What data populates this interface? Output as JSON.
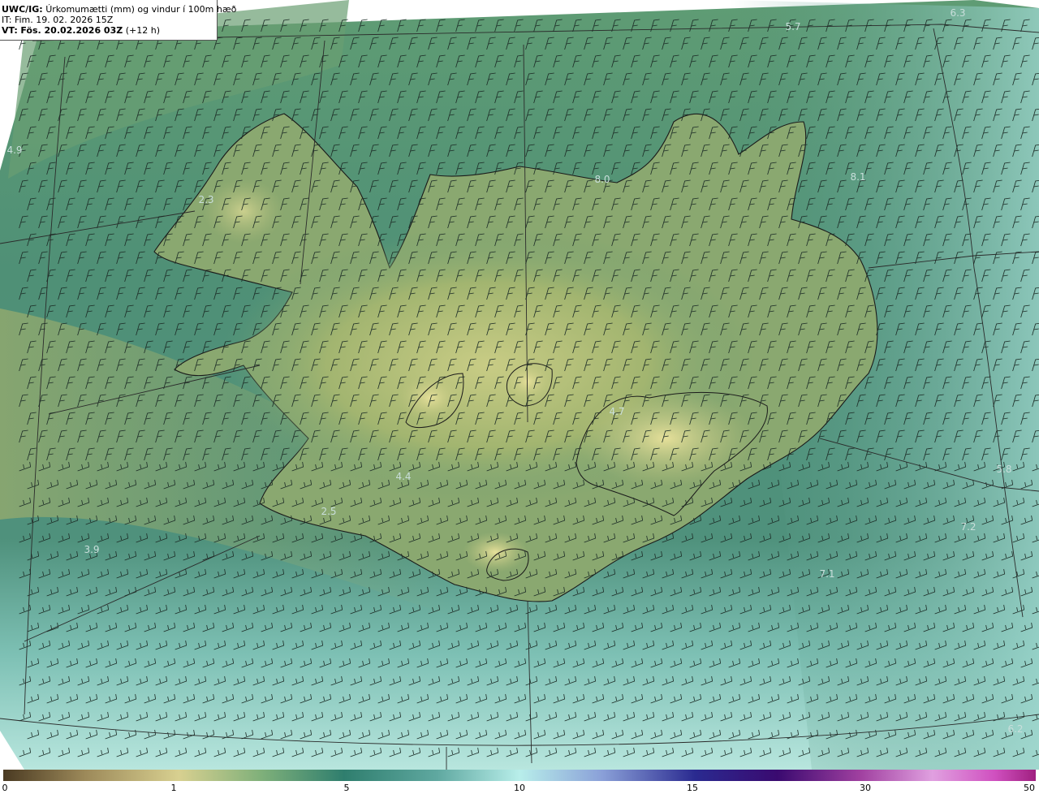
{
  "header": {
    "model_label": "UWC/IG:",
    "product": "Úrkomumætti (mm) og vindur í 100m hæð",
    "init_time": "IT: Fim. 19. 02. 2026 15Z",
    "valid_label": "VT:",
    "valid_time": "Fös. 20.02.2026 03Z",
    "lead_time": "(+12 h)"
  },
  "colorbar": {
    "ticks": [
      "0",
      "1",
      "5",
      "10",
      "15",
      "30",
      "50"
    ],
    "colors": [
      "#4a3a22",
      "#9d8a5a",
      "#d8d090",
      "#7fb07a",
      "#2f7e6e",
      "#5fa8a0",
      "#b8eeea",
      "#8aa0d8",
      "#2a2a90",
      "#3a0a70",
      "#a040a0",
      "#e0a0e0",
      "#d050c0",
      "#a02080"
    ]
  },
  "map_values": [
    {
      "id": "v1",
      "text": "5.7"
    },
    {
      "id": "v2",
      "text": "6.3"
    },
    {
      "id": "v3",
      "text": "4.9"
    },
    {
      "id": "v4",
      "text": "4.4"
    },
    {
      "id": "v5",
      "text": "2.5"
    },
    {
      "id": "v6",
      "text": "3.9"
    },
    {
      "id": "v7",
      "text": "5.8"
    },
    {
      "id": "v8",
      "text": "7.2"
    },
    {
      "id": "v9",
      "text": "7.1"
    },
    {
      "id": "v10",
      "text": "6.2"
    },
    {
      "id": "v11",
      "text": "8.0"
    },
    {
      "id": "v12",
      "text": "8.1"
    },
    {
      "id": "v13",
      "text": "4.7"
    },
    {
      "id": "v14",
      "text": "2.3"
    }
  ]
}
